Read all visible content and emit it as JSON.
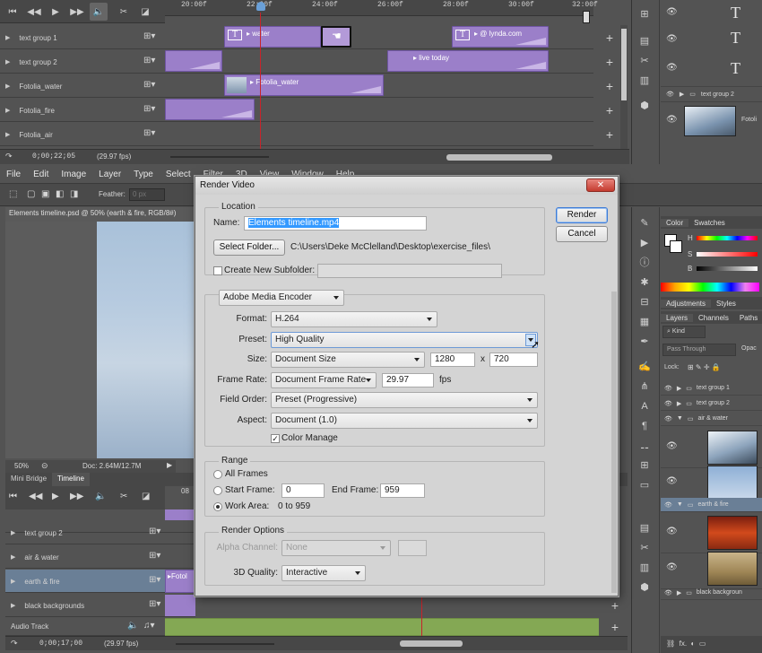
{
  "top_timeline": {
    "ruler": [
      "20:00f",
      "22:00f",
      "24:00f",
      "26:00f",
      "28:00f",
      "30:00f",
      "32:00f"
    ],
    "tracks": [
      {
        "name": "text group 1"
      },
      {
        "name": "text group 2"
      },
      {
        "name": "Fotolia_water"
      },
      {
        "name": "Fotolia_fire"
      },
      {
        "name": "Fotolia_air"
      }
    ],
    "clips": {
      "water": "water",
      "lynda": "@ lynda.com",
      "live_today": "live today",
      "fotolia_water": "Fotolia_water"
    },
    "time_display": "0;00;22;05",
    "fps": "(29.97 fps)"
  },
  "right_top": {
    "text_glyph": "T",
    "layers": [
      {
        "name": "text group 2"
      }
    ],
    "thumb_label": "Fotoli"
  },
  "menubar": [
    "File",
    "Edit",
    "Image",
    "Layer",
    "Type",
    "Select",
    "Filter",
    "3D",
    "View",
    "Window",
    "Help"
  ],
  "options": {
    "feather_label": "Feather:",
    "feather_value": "0 px"
  },
  "document": {
    "tab_title": "Elements timeline.psd @ 50% (earth & fire, RGB/8#)",
    "zoom": "50%",
    "doc_size": "Doc: 2.64M/12.7M"
  },
  "bottom_panel": {
    "tabs": [
      "Mini Bridge",
      "Timeline"
    ],
    "tracks": [
      {
        "name": "text group 2"
      },
      {
        "name": "air & water"
      },
      {
        "name": "earth & fire"
      },
      {
        "name": "black backgrounds"
      },
      {
        "name": "Audio Track"
      }
    ],
    "clip_label": "Fotol",
    "time_display": "0;00;17;00",
    "fps": "(29.97 fps)",
    "ruler_label": "08"
  },
  "right_mid": {
    "color_tabs": [
      "Color",
      "Swatches"
    ],
    "slider_labels": [
      "H",
      "S",
      "B"
    ],
    "adj_tabs": [
      "Adjustments",
      "Styles"
    ],
    "layer_tabs": [
      "Layers",
      "Channels",
      "Paths"
    ],
    "kind": "Kind",
    "blend": "Pass Through",
    "opacity": "Opac",
    "lock": "Lock:",
    "layers": [
      {
        "name": "text group 1"
      },
      {
        "name": "text group 2"
      },
      {
        "name": "air & water"
      },
      {
        "name": "earth & fire"
      },
      {
        "name": "black backgroun"
      }
    ],
    "fx": "fx."
  },
  "dialog": {
    "title": "Render Video",
    "close": "✕",
    "location_title": "Location",
    "name_label": "Name:",
    "name_value": "Elements timeline.mp4",
    "select_folder": "Select Folder...",
    "folder_path": "C:\\Users\\Deke McClelland\\Desktop\\exercise_files\\",
    "create_subfolder": "Create New Subfolder:",
    "encoder": "Adobe Media Encoder",
    "format_label": "Format:",
    "format_value": "H.264",
    "preset_label": "Preset:",
    "preset_value": "High Quality",
    "size_label": "Size:",
    "size_value": "Document Size",
    "width": "1280",
    "x": "x",
    "height": "720",
    "framerate_label": "Frame Rate:",
    "framerate_value": "Document Frame Rate",
    "fps_value": "29.97",
    "fps_unit": "fps",
    "field_order_label": "Field Order:",
    "field_order_value": "Preset (Progressive)",
    "aspect_label": "Aspect:",
    "aspect_value": "Document (1.0)",
    "color_manage": "Color Manage",
    "render": "Render",
    "cancel": "Cancel",
    "range_title": "Range",
    "all_frames": "All Frames",
    "start_frame": "Start Frame:",
    "start_value": "0",
    "end_frame": "End Frame:",
    "end_value": "959",
    "work_area": "Work Area:",
    "work_area_value": "0 to 959",
    "render_options_title": "Render Options",
    "alpha_label": "Alpha Channel:",
    "alpha_value": "None",
    "quality_label": "3D Quality:",
    "quality_value": "Interactive"
  }
}
